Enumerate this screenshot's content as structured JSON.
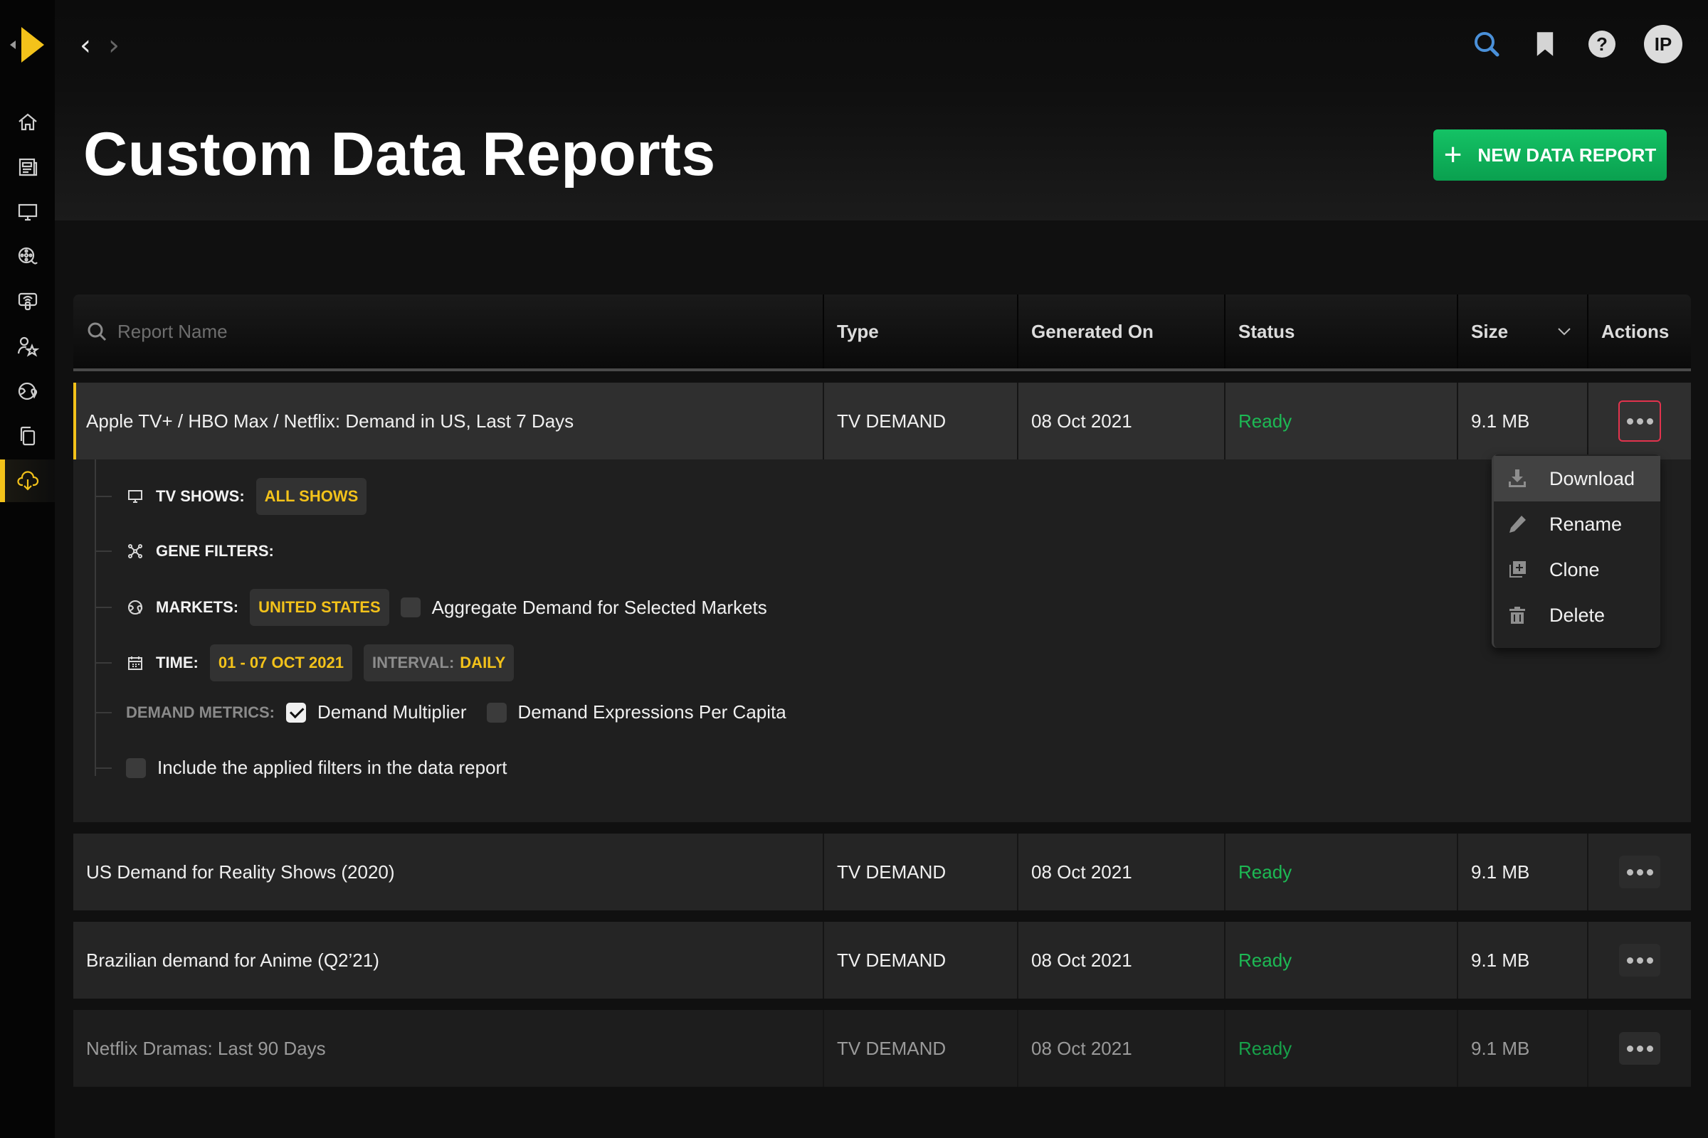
{
  "sidebar": {
    "logo": "play-logo",
    "items": [
      {
        "icon": "home-icon",
        "label": "Home"
      },
      {
        "icon": "news-icon",
        "label": "News"
      },
      {
        "icon": "tv-icon",
        "label": "TV"
      },
      {
        "icon": "film-search-icon",
        "label": "Discover"
      },
      {
        "icon": "streaming-icon",
        "label": "Platforms"
      },
      {
        "icon": "talent-icon",
        "label": "Talent"
      },
      {
        "icon": "globe-icon",
        "label": "Markets"
      },
      {
        "icon": "copy-icon",
        "label": "Compare"
      },
      {
        "icon": "cloud-download-icon",
        "label": "Data Reports",
        "active": true
      }
    ]
  },
  "nav": {
    "back": "‹",
    "forward": "›"
  },
  "header": {
    "title": "Custom Data Reports",
    "new_button": "NEW DATA REPORT",
    "new_button_icon": "+",
    "help": "?",
    "avatar": "IP",
    "search_icon_color": "#4a90d9",
    "accent": "#f3c21a",
    "green": "#14c265"
  },
  "table": {
    "search_placeholder": "Report Name",
    "columns": [
      "Type",
      "Generated On",
      "Status",
      "Size",
      "Actions"
    ],
    "sort_icon": "chevron-down-icon",
    "rows": [
      {
        "name": "Apple TV+ / HBO Max / Netflix: Demand in US, Last 7 Days",
        "type": "TV DEMAND",
        "generated": "08 Oct 2021",
        "status": "Ready",
        "size": "9.1 MB",
        "expanded": true
      },
      {
        "name": "US Demand for Reality Shows (2020)",
        "type": "TV DEMAND",
        "generated": "08 Oct 2021",
        "status": "Ready",
        "size": "9.1 MB"
      },
      {
        "name": "Brazilian demand for Anime (Q2’21)",
        "type": "TV DEMAND",
        "generated": "08 Oct 2021",
        "status": "Ready",
        "size": "9.1 MB"
      },
      {
        "name": "Netflix Dramas: Last 90 Days",
        "type": "TV DEMAND",
        "generated": "08 Oct 2021",
        "status": "Ready",
        "size": "9.1 MB"
      }
    ]
  },
  "details": {
    "tv_shows_label": "TV SHOWS:",
    "tv_shows_value": "ALL SHOWS",
    "gene_label": "GENE FILTERS:",
    "markets_label": "MARKETS:",
    "markets_value": "UNITED STATES",
    "aggregate_label": "Aggregate Demand for Selected Markets",
    "aggregate_checked": false,
    "time_label": "TIME:",
    "time_value": "01 - 07 OCT 2021",
    "interval_label": "INTERVAL:",
    "interval_value": "DAILY",
    "metrics_label": "DEMAND METRICS:",
    "metric1": "Demand Multiplier",
    "metric1_checked": true,
    "metric2": "Demand Expressions Per Capita",
    "metric2_checked": false,
    "include_label": "Include the applied filters in the data report",
    "include_checked": false
  },
  "menu": {
    "items": [
      {
        "label": "Download",
        "icon": "download-icon"
      },
      {
        "label": "Rename",
        "icon": "pencil-icon"
      },
      {
        "label": "Clone",
        "icon": "clone-icon"
      },
      {
        "label": "Delete",
        "icon": "trash-icon"
      }
    ]
  }
}
